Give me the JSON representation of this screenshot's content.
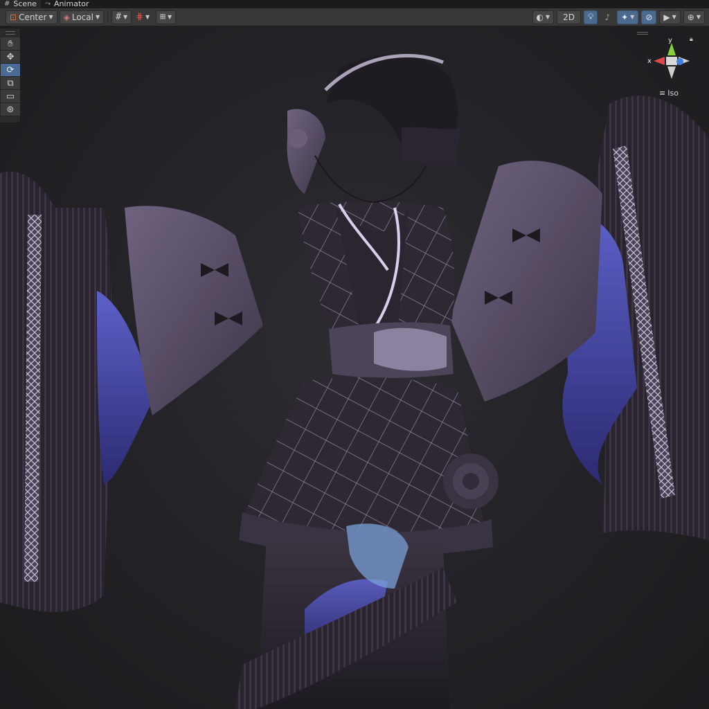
{
  "tabs": [
    {
      "label": "Scene",
      "icon": "grid-icon",
      "active": true
    },
    {
      "label": "Animator",
      "icon": "animator-icon",
      "active": false
    }
  ],
  "toolbar": {
    "pivot_label": "Center",
    "space_label": "Local",
    "view_2d_label": "2D"
  },
  "gizmo": {
    "y_label": "y",
    "x_label": "x",
    "projection_label": "Iso"
  },
  "colors": {
    "accent_active": "#4c6a8f",
    "x_axis": "#e04848",
    "y_axis": "#86d13a",
    "z_axis": "#3f7fe0"
  }
}
